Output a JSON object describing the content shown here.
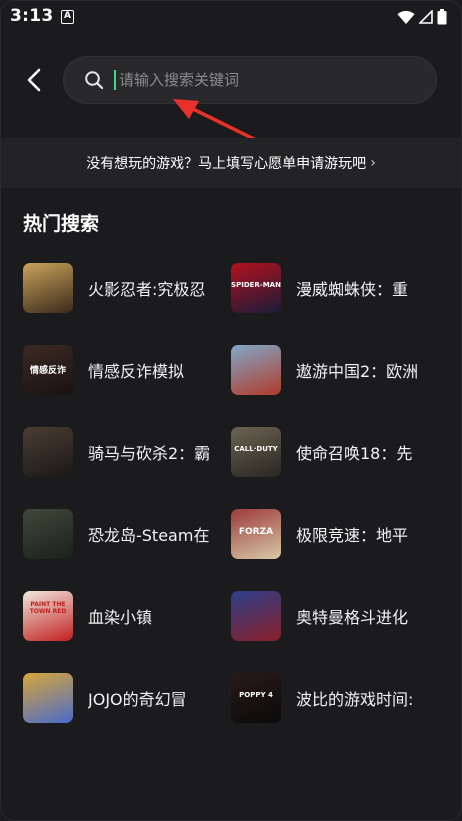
{
  "status_bar": {
    "time": "3:13",
    "notification_glyph": "A",
    "icons": [
      "wifi-icon",
      "signal-icon",
      "battery-icon"
    ]
  },
  "search": {
    "placeholder": "请输入搜索关键词",
    "value": ""
  },
  "banner": {
    "text": "没有想玩的游戏？马上填写心愿单申请游玩吧",
    "chevron": "›"
  },
  "hot_search": {
    "title": "热门搜索",
    "items": [
      {
        "name": "火影忍者:究极忍",
        "thumb_colors": [
          "#c9a35a",
          "#3b2a1d"
        ],
        "thumb_text": "",
        "side": "left"
      },
      {
        "name": "漫威蜘蛛侠：重",
        "thumb_colors": [
          "#b3121c",
          "#1a1a3a"
        ],
        "thumb_text": "SPIDER-MAN",
        "side": "right"
      },
      {
        "name": "情感反诈模拟",
        "thumb_colors": [
          "#3a2a22",
          "#1a1210"
        ],
        "thumb_text": "情感反诈",
        "side": "left"
      },
      {
        "name": "遨游中国2：欧洲",
        "thumb_colors": [
          "#7fa7c9",
          "#b23b2a"
        ],
        "thumb_text": "",
        "side": "right"
      },
      {
        "name": "骑马与砍杀2：霸",
        "thumb_colors": [
          "#4a3d33",
          "#1c1816"
        ],
        "thumb_text": "",
        "side": "left"
      },
      {
        "name": "使命召唤18：先",
        "thumb_colors": [
          "#6b6354",
          "#2a2620"
        ],
        "thumb_text": "CALL·DUTY",
        "side": "right"
      },
      {
        "name": "恐龙岛-Steam在",
        "thumb_colors": [
          "#3d4a3a",
          "#1a201a"
        ],
        "thumb_text": "",
        "side": "left"
      },
      {
        "name": "极限竞速：地平",
        "thumb_colors": [
          "#9b3a3a",
          "#d8c9a8"
        ],
        "thumb_text": "FORZA",
        "side": "right"
      },
      {
        "name": "血染小镇",
        "thumb_colors": [
          "#f0e8df",
          "#c0201f"
        ],
        "thumb_text": "PAINT THE TOWN RED",
        "side": "left"
      },
      {
        "name": "奥特曼格斗进化",
        "thumb_colors": [
          "#2b3f8a",
          "#8a1f2a"
        ],
        "thumb_text": "",
        "side": "right"
      },
      {
        "name": "JOJO的奇幻冒",
        "thumb_colors": [
          "#d8a63a",
          "#4b6bc9"
        ],
        "thumb_text": "",
        "side": "left"
      },
      {
        "name": "波比的游戏时间:",
        "thumb_colors": [
          "#2a1a1a",
          "#0a0a0a"
        ],
        "thumb_text": "POPPY 4",
        "side": "right"
      }
    ]
  }
}
